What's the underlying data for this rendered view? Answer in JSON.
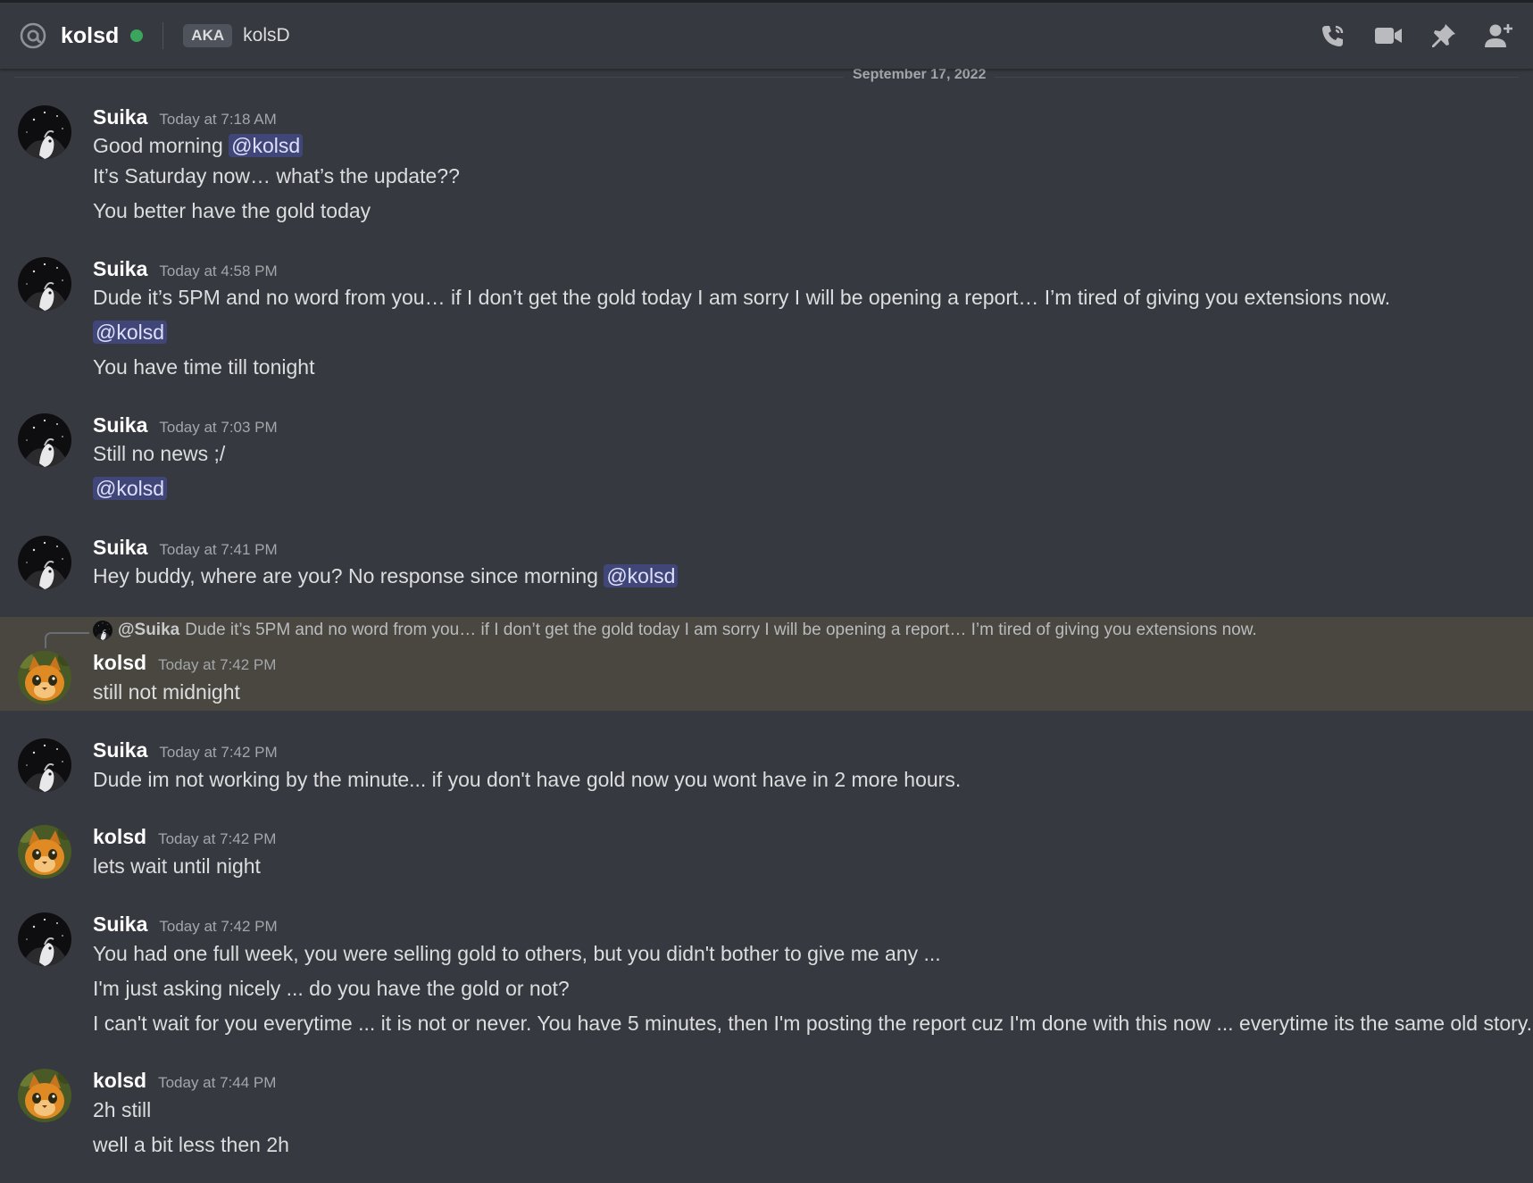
{
  "header": {
    "channel_icon": "at-icon",
    "title": "kolsd",
    "status": "online",
    "aka_label": "AKA",
    "alias": "kolsD",
    "toolbar_icons": [
      "phone-call-icon",
      "video-call-icon",
      "pin-icon",
      "add-friend-icon"
    ]
  },
  "date_divider": "September 17, 2022",
  "reply": {
    "user": "@Suika",
    "text": "Dude it’s 5PM and no word from you… if I don’t get the gold today I am sorry I will be opening a report… I’m tired of giving you extensions now."
  },
  "messages": [
    {
      "author": "Suika",
      "time": "Today at 7:18 AM",
      "lines": [
        {
          "text": "Good morning ",
          "mention": "@kolsd"
        },
        {
          "text": "It’s Saturday now… what’s the update??"
        },
        {
          "text": "You better have the gold today"
        }
      ]
    },
    {
      "author": "Suika",
      "time": "Today at 4:58 PM",
      "lines": [
        {
          "text": "Dude it’s 5PM and no word from you… if I don’t get the gold today I am sorry I will be opening a report… I’m tired of giving you extensions now."
        },
        {
          "text": "",
          "mention": "@kolsd"
        },
        {
          "text": "You have time till tonight"
        }
      ]
    },
    {
      "author": "Suika",
      "time": "Today at 7:03 PM",
      "lines": [
        {
          "text": "Still no news ;/"
        },
        {
          "text": "",
          "mention": "@kolsd"
        }
      ]
    },
    {
      "author": "Suika",
      "time": "Today at 7:41 PM",
      "lines": [
        {
          "text": "Hey buddy, where are you? No response since morning ",
          "mention": "@kolsd"
        }
      ]
    },
    {
      "author": "kolsd",
      "time": "Today at 7:42 PM",
      "lines": [
        {
          "text": "still not midnight"
        }
      ]
    },
    {
      "author": "Suika",
      "time": "Today at 7:42 PM",
      "lines": [
        {
          "text": "Dude im not working by the minute... if you don't have gold now you wont have in 2 more hours."
        }
      ]
    },
    {
      "author": "kolsd",
      "time": "Today at 7:42 PM",
      "lines": [
        {
          "text": "lets wait until night"
        }
      ]
    },
    {
      "author": "Suika",
      "time": "Today at 7:42 PM",
      "lines": [
        {
          "text": "You had one full week, you were selling gold to others, but you didn't bother to give me any ..."
        },
        {
          "text": "I'm just asking nicely ... do you have the gold or not?"
        },
        {
          "text": "I can't wait for you everytime ... it is not or never. You have 5 minutes, then I'm posting the report cuz I'm done with this now ... everytime its the same old story."
        }
      ]
    },
    {
      "author": "kolsd",
      "time": "Today at 7:44 PM",
      "lines": [
        {
          "text": "2h still"
        },
        {
          "text": "well a bit less then 2h"
        }
      ]
    }
  ],
  "colors": {
    "background": "#36393f",
    "header_bg": "#36393f",
    "highlight_bg": "#4a4740",
    "mention_bg": "#4e5490",
    "online": "#3ba55d",
    "username": "#ffffff",
    "muted": "#a3a6aa",
    "text": "#dcddde"
  }
}
